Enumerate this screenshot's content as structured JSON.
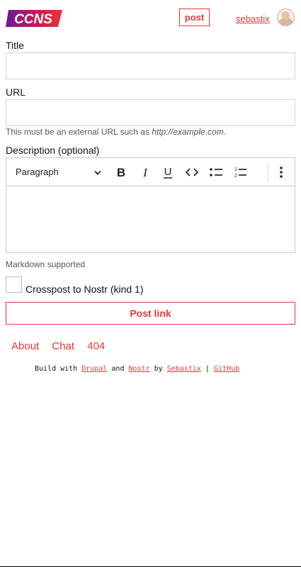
{
  "header": {
    "logo_text": "CCNS",
    "post_button": "post",
    "username": "sebastix"
  },
  "form": {
    "title_label": "Title",
    "title_value": "",
    "url_label": "URL",
    "url_value": "",
    "url_help_prefix": "This must be an external URL such as ",
    "url_help_example": "http://example.com",
    "url_help_suffix": ".",
    "description_label": "Description (optional)",
    "editor": {
      "block_format": "Paragraph",
      "toolbar": [
        "bold",
        "italic",
        "underline",
        "code",
        "bulleted-list",
        "numbered-list",
        "more"
      ]
    },
    "markdown_note": "Markdown supported",
    "crosspost_label": "Crosspost to Nostr (kind 1)",
    "crosspost_checked": false,
    "submit_label": "Post link"
  },
  "footer": {
    "nav": [
      "About",
      "Chat",
      "404"
    ],
    "credits": {
      "build_with": "Build with",
      "drupal": "Drupal",
      "and": "and",
      "nostr": "Nostr",
      "by": "by",
      "sebastix": "Sebastix",
      "sep": "|",
      "github": "GitHub"
    }
  },
  "colors": {
    "accent": "#e53935",
    "logo_gradient_start": "#7b1fa2",
    "logo_gradient_end": "#e53935"
  }
}
